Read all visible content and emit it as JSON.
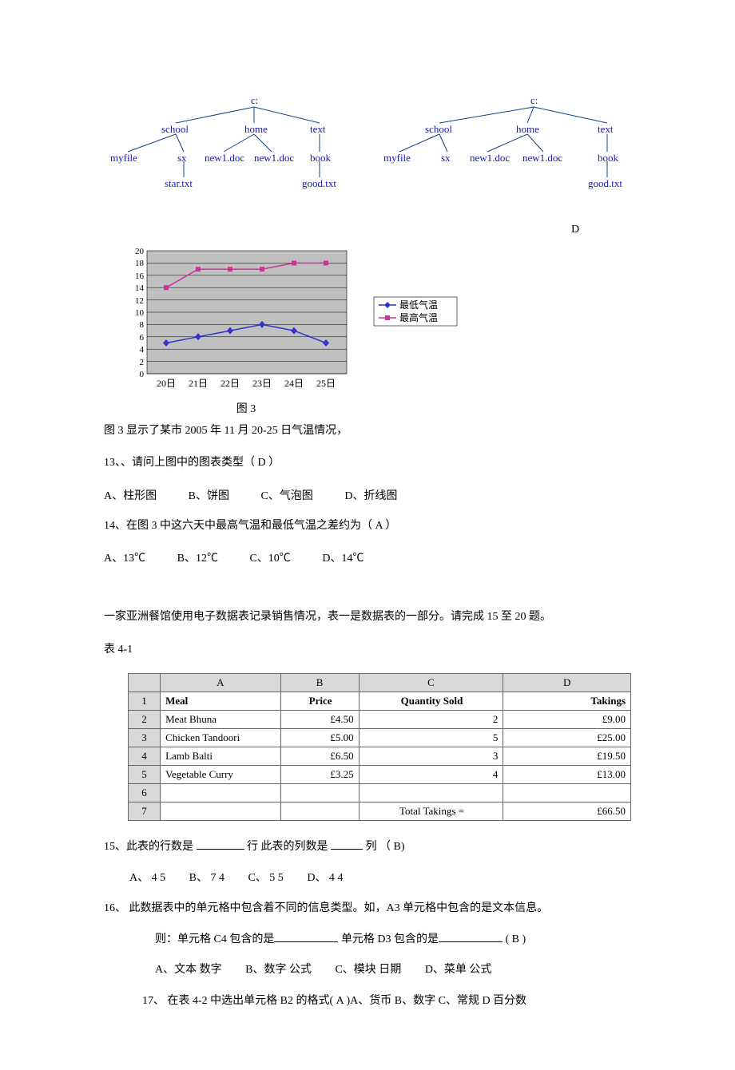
{
  "trees": {
    "left": {
      "root": "c:",
      "children": [
        {
          "label": "school",
          "children": [
            {
              "label": "myfile"
            },
            {
              "label": "sx",
              "children": [
                {
                  "label": "star.txt"
                }
              ]
            }
          ]
        },
        {
          "label": "home",
          "children": [
            {
              "label": "new1.doc"
            },
            {
              "label": "new1.doc"
            }
          ]
        },
        {
          "label": "text",
          "children": [
            {
              "label": "book",
              "children": [
                {
                  "label": "good.txt"
                }
              ]
            }
          ]
        }
      ]
    },
    "right": {
      "root": "c:",
      "children": [
        {
          "label": "school",
          "children": [
            {
              "label": "myfile"
            },
            {
              "label": "sx"
            }
          ]
        },
        {
          "label": "home",
          "children": [
            {
              "label": "new1.doc"
            },
            {
              "label": "new1.doc"
            }
          ]
        },
        {
          "label": "text",
          "children": [
            {
              "label": "book",
              "children": [
                {
                  "label": "good.txt"
                }
              ]
            }
          ]
        }
      ]
    }
  },
  "option_d": "D",
  "chart_data": {
    "type": "line",
    "categories": [
      "20日",
      "21日",
      "22日",
      "23日",
      "24日",
      "25日"
    ],
    "series": [
      {
        "name": "最低气温",
        "values": [
          5,
          6,
          7,
          8,
          7,
          5
        ],
        "color": "#3333cc"
      },
      {
        "name": "最高气温",
        "values": [
          14,
          17,
          17,
          17,
          18,
          18
        ],
        "color": "#cc3399"
      }
    ],
    "ylim": [
      0,
      20
    ],
    "yticks": [
      0,
      2,
      4,
      6,
      8,
      10,
      12,
      14,
      16,
      18,
      20
    ],
    "caption": "图 3",
    "legend_labels": {
      "low": "最低气温",
      "high": "最高气温"
    }
  },
  "chart_intro": "图 3 显示了某市 2005 年 11 月 20-25 日气温情况，",
  "q13": {
    "stem": "13、、请问上图中的图表类型（  D    ）",
    "opts": {
      "A": "A、柱形图",
      "B": "B、饼图",
      "C": "C、气泡图",
      "D": "D、折线图"
    }
  },
  "q14": {
    "stem": "14、在图 3 中这六天中最高气温和最低气温之差约为（  A    ）",
    "opts": {
      "A": "A、13℃",
      "B": "B、12℃",
      "C": "C、10℃",
      "D": "D、14℃"
    }
  },
  "restaurant_intro": "一家亚洲餐馆使用电子数据表记录销售情况，表一是数据表的一部分。请完成 15 至 20 题。",
  "table_label": "表    4-1",
  "sales_table": {
    "col_heads": [
      "A",
      "B",
      "C",
      "D"
    ],
    "row_heads": [
      "1",
      "2",
      "3",
      "4",
      "5",
      "6",
      "7"
    ],
    "header_row": {
      "A": "Meal",
      "B": "Price",
      "C": "Quantity Sold",
      "D": "Takings"
    },
    "rows": [
      {
        "A": "Meat Bhuna",
        "B": "£4.50",
        "C": "2",
        "D": "£9.00"
      },
      {
        "A": "Chicken Tandoori",
        "B": "£5.00",
        "C": "5",
        "D": "£25.00"
      },
      {
        "A": "Lamb Balti",
        "B": "£6.50",
        "C": "3",
        "D": "£19.50"
      },
      {
        "A": "Vegetable Curry",
        "B": "£3.25",
        "C": "4",
        "D": "£13.00"
      },
      {
        "A": "",
        "B": "",
        "C": "",
        "D": ""
      },
      {
        "A": "",
        "B": "",
        "C": "Total Takings =",
        "D": "£66.50"
      }
    ]
  },
  "q15": {
    "stem_pre": "15、此表的行数是 ",
    "mid1": "  行        此表的列数是  ",
    "mid2": "  列      （  B)",
    "opts": {
      "A": "A、   4  5",
      "B": "B、   7  4",
      "C": "C、   5  5",
      "D": "D、   4  4"
    }
  },
  "q16": {
    "line1": "16、   此数据表中的单元格中包含着不同的信息类型。如，A3 单元格中包含的是文本信息。",
    "line2_pre": "则：单元格 C4 包含的是",
    "line2_mid": "     单元格 D3 包含的是",
    "line2_suf": "   ( B )",
    "opts": {
      "A": "A、文本   数字",
      "B": "B、数字   公式",
      "C": "C、模块   日期",
      "D": "D、菜单   公式"
    }
  },
  "q17": {
    "line": "17、   在表 4-2 中选出单元格 B2 的格式( A )A、货币   B、数字   C、常规   D 百分数"
  }
}
